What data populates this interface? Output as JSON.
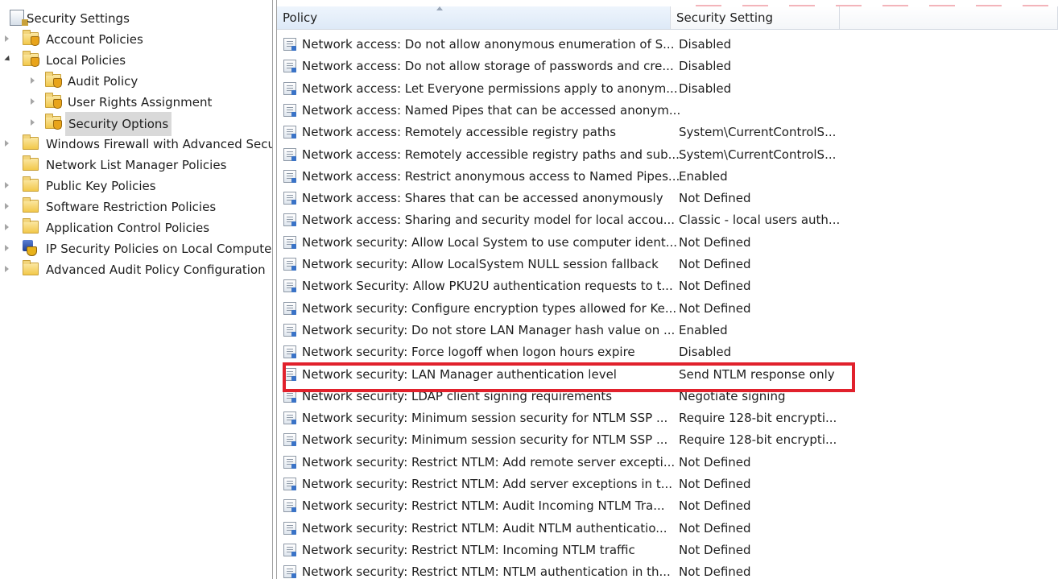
{
  "tree": {
    "root": {
      "label": "Security Settings",
      "icon": "security-settings-icon"
    },
    "items": [
      {
        "label": "Account Policies",
        "icon": "folder-shield-icon",
        "expander": "collapsed"
      },
      {
        "label": "Local Policies",
        "icon": "folder-shield-icon",
        "expander": "expanded"
      },
      {
        "label": "Audit Policy",
        "icon": "folder-shield-icon",
        "expander": "collapsed"
      },
      {
        "label": "User Rights Assignment",
        "icon": "folder-shield-icon",
        "expander": "collapsed"
      },
      {
        "label": "Security Options",
        "icon": "folder-shield-icon",
        "expander": "collapsed",
        "selected": true
      },
      {
        "label": "Windows Firewall with Advanced Secu",
        "icon": "folder-icon",
        "expander": "collapsed"
      },
      {
        "label": "Network List Manager Policies",
        "icon": "folder-icon",
        "expander": "none"
      },
      {
        "label": "Public Key Policies",
        "icon": "folder-icon",
        "expander": "collapsed"
      },
      {
        "label": "Software Restriction Policies",
        "icon": "folder-icon",
        "expander": "collapsed"
      },
      {
        "label": "Application Control Policies",
        "icon": "folder-icon",
        "expander": "collapsed"
      },
      {
        "label": "IP Security Policies on Local Compute",
        "icon": "ipsec-icon",
        "expander": "collapsed"
      },
      {
        "label": "Advanced Audit Policy Configuration",
        "icon": "folder-icon",
        "expander": "collapsed"
      }
    ]
  },
  "list": {
    "columns": {
      "policy": "Policy",
      "setting": "Security Setting"
    },
    "sorted_column": "policy",
    "rows": [
      {
        "policy": "Network access: Do not allow anonymous enumeration of S...",
        "setting": "Disabled"
      },
      {
        "policy": "Network access: Do not allow storage of passwords and cre...",
        "setting": "Disabled"
      },
      {
        "policy": "Network access: Let Everyone permissions apply to anonym...",
        "setting": "Disabled"
      },
      {
        "policy": "Network access: Named Pipes that can be accessed anonym...",
        "setting": ""
      },
      {
        "policy": "Network access: Remotely accessible registry paths",
        "setting": "System\\CurrentControlS..."
      },
      {
        "policy": "Network access: Remotely accessible registry paths and sub...",
        "setting": "System\\CurrentControlS..."
      },
      {
        "policy": "Network access: Restrict anonymous access to Named Pipes...",
        "setting": "Enabled"
      },
      {
        "policy": "Network access: Shares that can be accessed anonymously",
        "setting": "Not Defined"
      },
      {
        "policy": "Network access: Sharing and security model for local accou...",
        "setting": "Classic - local users auth..."
      },
      {
        "policy": "Network security: Allow Local System to use computer ident...",
        "setting": "Not Defined"
      },
      {
        "policy": "Network security: Allow LocalSystem NULL session fallback",
        "setting": "Not Defined"
      },
      {
        "policy": "Network Security: Allow PKU2U authentication requests to t...",
        "setting": "Not Defined"
      },
      {
        "policy": "Network security: Configure encryption types allowed for Ke...",
        "setting": "Not Defined"
      },
      {
        "policy": "Network security: Do not store LAN Manager hash value on ...",
        "setting": "Enabled"
      },
      {
        "policy": "Network security: Force logoff when logon hours expire",
        "setting": "Disabled"
      },
      {
        "policy": "Network security: LAN Manager authentication level",
        "setting": "Send NTLM response only",
        "highlighted": true
      },
      {
        "policy": "Network security: LDAP client signing requirements",
        "setting": "Negotiate signing"
      },
      {
        "policy": "Network security: Minimum session security for NTLM SSP ...",
        "setting": "Require 128-bit encrypti..."
      },
      {
        "policy": "Network security: Minimum session security for NTLM SSP ...",
        "setting": "Require 128-bit encrypti..."
      },
      {
        "policy": "Network security: Restrict NTLM: Add remote server excepti...",
        "setting": "Not Defined"
      },
      {
        "policy": "Network security: Restrict NTLM: Add server exceptions in t...",
        "setting": "Not Defined"
      },
      {
        "policy": "Network security: Restrict NTLM: Audit Incoming NTLM Tra...",
        "setting": "Not Defined"
      },
      {
        "policy": "Network security: Restrict NTLM: Audit NTLM authenticatio...",
        "setting": "Not Defined"
      },
      {
        "policy": "Network security: Restrict NTLM: Incoming NTLM traffic",
        "setting": "Not Defined"
      },
      {
        "policy": "Network security: Restrict NTLM: NTLM authentication in th...",
        "setting": "Not Defined"
      }
    ]
  },
  "colors": {
    "highlight_border": "#e1212c",
    "selected_bg": "#d9d9d9"
  }
}
